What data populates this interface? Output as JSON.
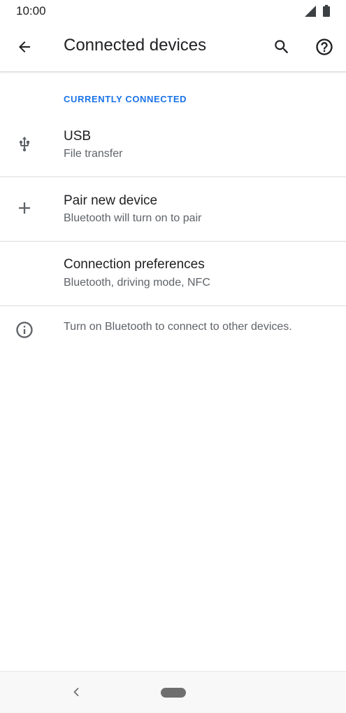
{
  "status_bar": {
    "time": "10:00",
    "icons": [
      "signal-icon",
      "battery-icon"
    ]
  },
  "app_bar": {
    "title": "Connected devices",
    "back_icon": "arrow-back-icon",
    "search_icon": "search-icon",
    "help_icon": "help-icon"
  },
  "section": {
    "header": "CURRENTLY CONNECTED"
  },
  "items": [
    {
      "title": "USB",
      "summary": "File transfer",
      "icon": "usb-icon"
    },
    {
      "title": "Pair new device",
      "summary": "Bluetooth will turn on to pair",
      "icon": "plus-icon"
    },
    {
      "title": "Connection preferences",
      "summary": "Bluetooth, driving mode, NFC",
      "icon": ""
    }
  ],
  "footer": {
    "info_text": "Turn on Bluetooth to connect to other devices.",
    "icon": "info-icon"
  },
  "nav_bar": {
    "back_icon": "nav-back-icon",
    "home_icon": "home-pill-icon"
  },
  "colors": {
    "accent": "#1a73e8",
    "text_primary": "#202124",
    "text_secondary": "#5f6368",
    "divider": "#dadce0"
  }
}
